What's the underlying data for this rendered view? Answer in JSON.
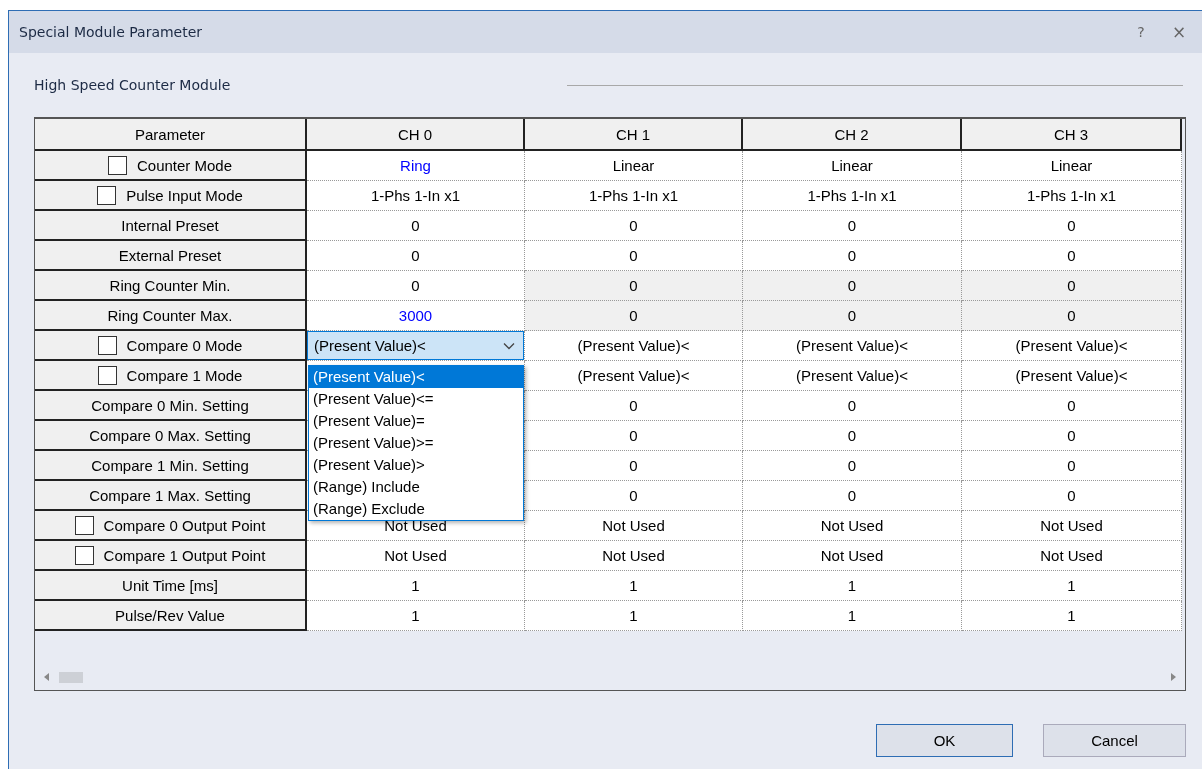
{
  "window": {
    "title": "Special Module Parameter",
    "help": "?",
    "close": "×"
  },
  "section_title": "High Speed Counter Module",
  "table": {
    "parameter_header": "Parameter",
    "channels": [
      "CH 0",
      "CH 1",
      "CH 2",
      "CH 3"
    ],
    "rows": [
      {
        "label": "Counter Mode",
        "checked": false,
        "cells": [
          {
            "text": "Ring",
            "kind": "changed"
          },
          {
            "text": "Linear",
            "kind": "plain"
          },
          {
            "text": "Linear",
            "kind": "plain"
          },
          {
            "text": "Linear",
            "kind": "plain"
          }
        ]
      },
      {
        "label": "Pulse Input Mode",
        "checked": false,
        "cells": [
          {
            "text": "1-Phs 1-In x1",
            "kind": "plain"
          },
          {
            "text": "1-Phs 1-In x1",
            "kind": "plain"
          },
          {
            "text": "1-Phs 1-In x1",
            "kind": "plain"
          },
          {
            "text": "1-Phs 1-In x1",
            "kind": "plain"
          }
        ]
      },
      {
        "label": "Internal Preset",
        "cells": [
          {
            "text": "0",
            "kind": "plain"
          },
          {
            "text": "0",
            "kind": "plain"
          },
          {
            "text": "0",
            "kind": "plain"
          },
          {
            "text": "0",
            "kind": "plain"
          }
        ]
      },
      {
        "label": "External Preset",
        "cells": [
          {
            "text": "0",
            "kind": "plain"
          },
          {
            "text": "0",
            "kind": "plain"
          },
          {
            "text": "0",
            "kind": "plain"
          },
          {
            "text": "0",
            "kind": "plain"
          }
        ]
      },
      {
        "label": "Ring Counter Min.",
        "cells": [
          {
            "text": "0",
            "kind": "plain"
          },
          {
            "text": "0",
            "kind": "disabled"
          },
          {
            "text": "0",
            "kind": "disabled"
          },
          {
            "text": "0",
            "kind": "disabled"
          }
        ]
      },
      {
        "label": "Ring Counter Max.",
        "cells": [
          {
            "text": "3000",
            "kind": "changed"
          },
          {
            "text": "0",
            "kind": "disabled"
          },
          {
            "text": "0",
            "kind": "disabled"
          },
          {
            "text": "0",
            "kind": "disabled"
          }
        ]
      },
      {
        "label": "Compare 0 Mode",
        "checked": false,
        "cells": [
          {
            "text": "(Present Value)<",
            "kind": "combo"
          },
          {
            "text": "(Present Value)<",
            "kind": "plain"
          },
          {
            "text": "(Present Value)<",
            "kind": "plain"
          },
          {
            "text": "(Present Value)<",
            "kind": "plain"
          }
        ]
      },
      {
        "label": "Compare 1 Mode",
        "checked": false,
        "cells": [
          {
            "kind": "covered"
          },
          {
            "text": "(Present Value)<",
            "kind": "plain"
          },
          {
            "text": "(Present Value)<",
            "kind": "plain"
          },
          {
            "text": "(Present Value)<",
            "kind": "plain"
          }
        ]
      },
      {
        "label": "Compare 0 Min. Setting",
        "cells": [
          {
            "kind": "covered"
          },
          {
            "text": "0",
            "kind": "plain"
          },
          {
            "text": "0",
            "kind": "plain"
          },
          {
            "text": "0",
            "kind": "plain"
          }
        ]
      },
      {
        "label": "Compare 0 Max. Setting",
        "cells": [
          {
            "kind": "covered"
          },
          {
            "text": "0",
            "kind": "plain"
          },
          {
            "text": "0",
            "kind": "plain"
          },
          {
            "text": "0",
            "kind": "plain"
          }
        ]
      },
      {
        "label": "Compare 1 Min. Setting",
        "cells": [
          {
            "kind": "covered"
          },
          {
            "text": "0",
            "kind": "plain"
          },
          {
            "text": "0",
            "kind": "plain"
          },
          {
            "text": "0",
            "kind": "plain"
          }
        ]
      },
      {
        "label": "Compare 1 Max. Setting",
        "cells": [
          {
            "kind": "covered"
          },
          {
            "text": "0",
            "kind": "plain"
          },
          {
            "text": "0",
            "kind": "plain"
          },
          {
            "text": "0",
            "kind": "plain"
          }
        ]
      },
      {
        "label": "Compare 0 Output Point",
        "checked": false,
        "cells": [
          {
            "text": "Not Used",
            "kind": "plain"
          },
          {
            "text": "Not Used",
            "kind": "plain"
          },
          {
            "text": "Not Used",
            "kind": "plain"
          },
          {
            "text": "Not Used",
            "kind": "plain"
          }
        ]
      },
      {
        "label": "Compare 1 Output Point",
        "checked": false,
        "cells": [
          {
            "text": "Not Used",
            "kind": "plain"
          },
          {
            "text": "Not Used",
            "kind": "plain"
          },
          {
            "text": "Not Used",
            "kind": "plain"
          },
          {
            "text": "Not Used",
            "kind": "plain"
          }
        ]
      },
      {
        "label": "Unit Time [ms]",
        "cells": [
          {
            "text": "1",
            "kind": "plain"
          },
          {
            "text": "1",
            "kind": "plain"
          },
          {
            "text": "1",
            "kind": "plain"
          },
          {
            "text": "1",
            "kind": "plain"
          }
        ]
      },
      {
        "label": "Pulse/Rev Value",
        "cells": [
          {
            "text": "1",
            "kind": "plain"
          },
          {
            "text": "1",
            "kind": "plain"
          },
          {
            "text": "1",
            "kind": "plain"
          },
          {
            "text": "1",
            "kind": "plain"
          }
        ]
      }
    ]
  },
  "dropdown": {
    "options": [
      {
        "label": "(Present Value)<",
        "selected": true
      },
      {
        "label": "(Present Value)<=",
        "selected": false
      },
      {
        "label": "(Present Value)=",
        "selected": false
      },
      {
        "label": "(Present Value)>=",
        "selected": false
      },
      {
        "label": "(Present Value)>",
        "selected": false
      },
      {
        "label": "(Range) Include",
        "selected": false
      },
      {
        "label": "(Range) Exclude",
        "selected": false
      }
    ]
  },
  "buttons": [
    "OK",
    "Cancel"
  ]
}
